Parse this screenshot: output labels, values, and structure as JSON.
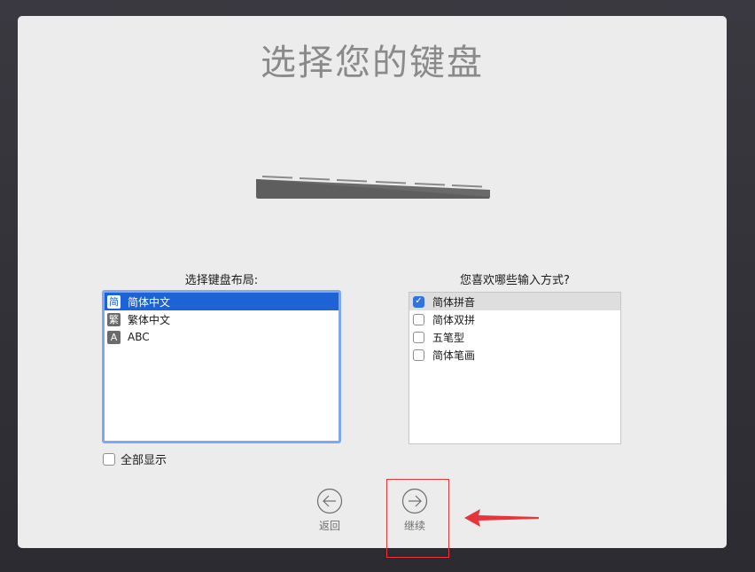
{
  "title": "选择您的键盘",
  "layout_section": {
    "label": "选择键盘布局:",
    "items": [
      {
        "badge": "简",
        "label": "简体中文",
        "selected": true
      },
      {
        "badge": "繁",
        "label": "繁体中文",
        "selected": false
      },
      {
        "badge": "A",
        "label": "ABC",
        "selected": false
      }
    ]
  },
  "input_section": {
    "label": "您喜欢哪些输入方式?",
    "items": [
      {
        "label": "简体拼音",
        "checked": true
      },
      {
        "label": "简体双拼",
        "checked": false
      },
      {
        "label": "五笔型",
        "checked": false
      },
      {
        "label": "简体笔画",
        "checked": false
      }
    ]
  },
  "show_all": {
    "label": "全部显示",
    "checked": false
  },
  "nav": {
    "back_label": "返回",
    "continue_label": "继续"
  },
  "colors": {
    "selection": "#1d63d6",
    "checkbox_accent": "#2f74e0",
    "annotation": "#e8343a"
  },
  "icons": {
    "back": "arrow-left-circle-icon",
    "continue": "arrow-right-circle-icon",
    "checkmark": "checkmark-icon"
  }
}
